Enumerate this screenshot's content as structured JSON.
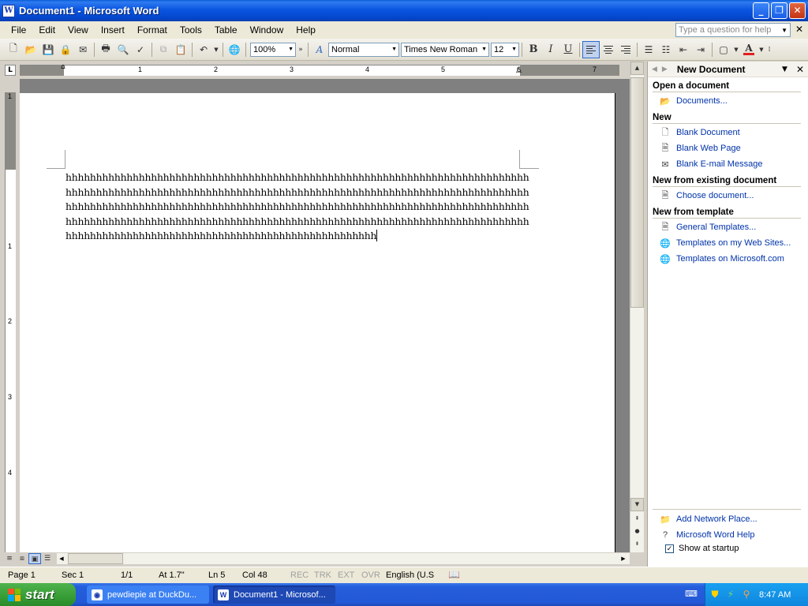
{
  "window": {
    "title": "Document1 - Microsoft Word",
    "app_icon": "W"
  },
  "menubar": {
    "items": [
      {
        "label": "File"
      },
      {
        "label": "Edit"
      },
      {
        "label": "View"
      },
      {
        "label": "Insert"
      },
      {
        "label": "Format"
      },
      {
        "label": "Tools"
      },
      {
        "label": "Table"
      },
      {
        "label": "Window"
      },
      {
        "label": "Help"
      }
    ],
    "help_placeholder": "Type a question for help"
  },
  "toolbar": {
    "zoom": "100%",
    "style": "Normal",
    "font": "Times New Roman",
    "font_size": "12",
    "bold_label": "B",
    "italic_label": "I",
    "underline_label": "U",
    "font_color_label": "A",
    "font_color": "#e02020",
    "highlight_label": "A"
  },
  "ruler": {
    "h_numbers": [
      "1",
      "2",
      "3",
      "4",
      "5",
      "6",
      "7"
    ],
    "v_numbers": [
      "1",
      "1",
      "2",
      "3",
      "4"
    ]
  },
  "document": {
    "lines": [
      "hhhhhhhhhhhhhhhhhhhhhhhhhhhhhhhhhhhhhhhhhhhhhhhhhhhhhhhhhhhhhhhhhhhhhhhhhhhh",
      "hhhhhhhhhhhhhhhhhhhhhhhhhhhhhhhhhhhhhhhhhhhhhhhhhhhhhhhhhhhhhhhhhhhhhhhhhhhh",
      "hhhhhhhhhhhhhhhhhhhhhhhhhhhhhhhhhhhhhhhhhhhhhhhhhhhhhhhhhhhhhhhhhhhhhhhhhhhh",
      "hhhhhhhhhhhhhhhhhhhhhhhhhhhhhhhhhhhhhhhhhhhhhhhhhhhhhhhhhhhhhhhhhhhhhhhhhhhh",
      "hhhhhhhhhhhhhhhhhhhhhhhhhhhhhhhhhhhhhhhhhhhhhhhhhhh"
    ]
  },
  "statusbar": {
    "page": "Page  1",
    "sec": "Sec  1",
    "pages": "1/1",
    "at": "At  1.7\"",
    "ln": "Ln  5",
    "col": "Col  48",
    "rec": "REC",
    "trk": "TRK",
    "ext": "EXT",
    "ovr": "OVR",
    "language": "English (U.S"
  },
  "taskpane": {
    "title": "New Document",
    "sections": {
      "open": "Open a document",
      "new": "New",
      "existing": "New from existing document",
      "template": "New from template"
    },
    "links": {
      "documents": "Documents...",
      "blank_document": "Blank Document",
      "blank_web_page": "Blank Web Page",
      "blank_email": "Blank E-mail Message",
      "choose_document": "Choose document...",
      "general_templates": "General Templates...",
      "web_sites_templates": "Templates on my Web Sites...",
      "microsoft_templates": "Templates on Microsoft.com",
      "add_network_place": "Add Network Place...",
      "word_help": "Microsoft Word Help",
      "show_at_startup": "Show at startup"
    },
    "show_at_startup_checked": true
  },
  "taskbar": {
    "start_label": "start",
    "tasks": [
      {
        "label": "pewdiepie at DuckDu..."
      },
      {
        "label": "Document1 - Microsof..."
      }
    ],
    "clock": "8:47 AM"
  }
}
